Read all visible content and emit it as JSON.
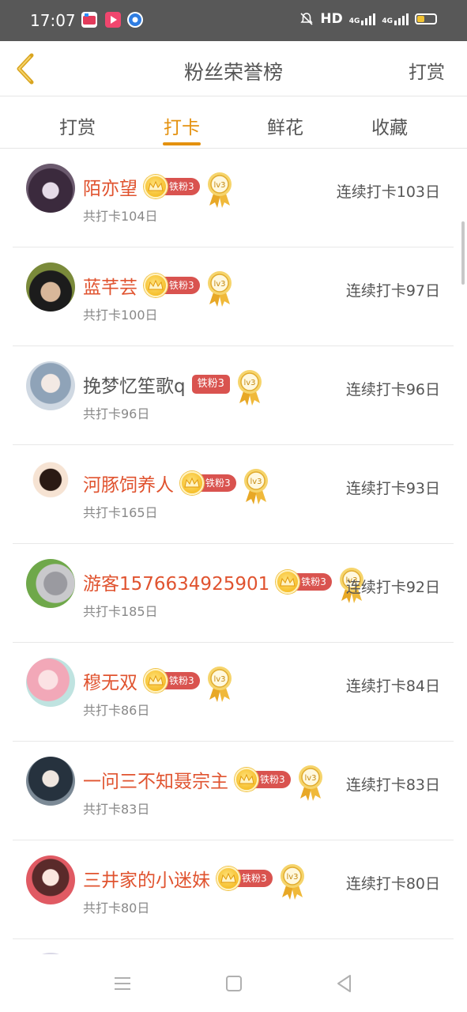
{
  "status_bar": {
    "time": "17:07",
    "network": "HD",
    "signal1": "4G",
    "signal2": "4G",
    "icons": [
      "video-app-icon",
      "play-app-icon",
      "browser-app-icon",
      "mute-bell-icon",
      "battery-icon"
    ]
  },
  "header": {
    "title": "粉丝荣誉榜",
    "action_label": "打赏",
    "back_icon": "back-chevron-icon"
  },
  "tabs": [
    {
      "label": "打赏",
      "active": false
    },
    {
      "label": "打卡",
      "active": true
    },
    {
      "label": "鲜花",
      "active": false
    },
    {
      "label": "收藏",
      "active": false
    }
  ],
  "fans": [
    {
      "name": "陌亦望",
      "badge": "铁粉3",
      "medal": "lv3",
      "total": "共打卡104日",
      "streak": "连续打卡103日",
      "crown": true,
      "highlight": true
    },
    {
      "name": "蓝芊芸",
      "badge": "铁粉3",
      "medal": "lv3",
      "total": "共打卡100日",
      "streak": "连续打卡97日",
      "crown": true,
      "highlight": true
    },
    {
      "name": "挽梦忆笙歌q",
      "badge": "铁粉3",
      "medal": "lv3",
      "total": "共打卡96日",
      "streak": "连续打卡96日",
      "crown": false,
      "highlight": false
    },
    {
      "name": "河豚饲养人",
      "badge": "铁粉3",
      "medal": "lv3",
      "total": "共打卡165日",
      "streak": "连续打卡93日",
      "crown": true,
      "highlight": true
    },
    {
      "name": "游客1576634925901",
      "badge": "铁粉3",
      "medal": "lv3",
      "total": "共打卡185日",
      "streak": "连续打卡92日",
      "crown": true,
      "highlight": true
    },
    {
      "name": "穆无双",
      "badge": "铁粉3",
      "medal": "lv3",
      "total": "共打卡86日",
      "streak": "连续打卡84日",
      "crown": true,
      "highlight": true
    },
    {
      "name": "一问三不知聂宗主",
      "badge": "铁粉3",
      "medal": "lv3",
      "total": "共打卡83日",
      "streak": "连续打卡83日",
      "crown": true,
      "highlight": true
    },
    {
      "name": "三井家的小迷妹",
      "badge": "铁粉3",
      "medal": "lv3",
      "total": "共打卡80日",
      "streak": "连续打卡80日",
      "crown": true,
      "highlight": true
    }
  ],
  "colors": {
    "accent": "#e4910f",
    "name_red": "#e0532f",
    "badge_red": "#d9534f",
    "crown_gold": "#f2b10d"
  },
  "nav_bar": [
    "menu-icon",
    "home-square-icon",
    "back-triangle-icon"
  ]
}
